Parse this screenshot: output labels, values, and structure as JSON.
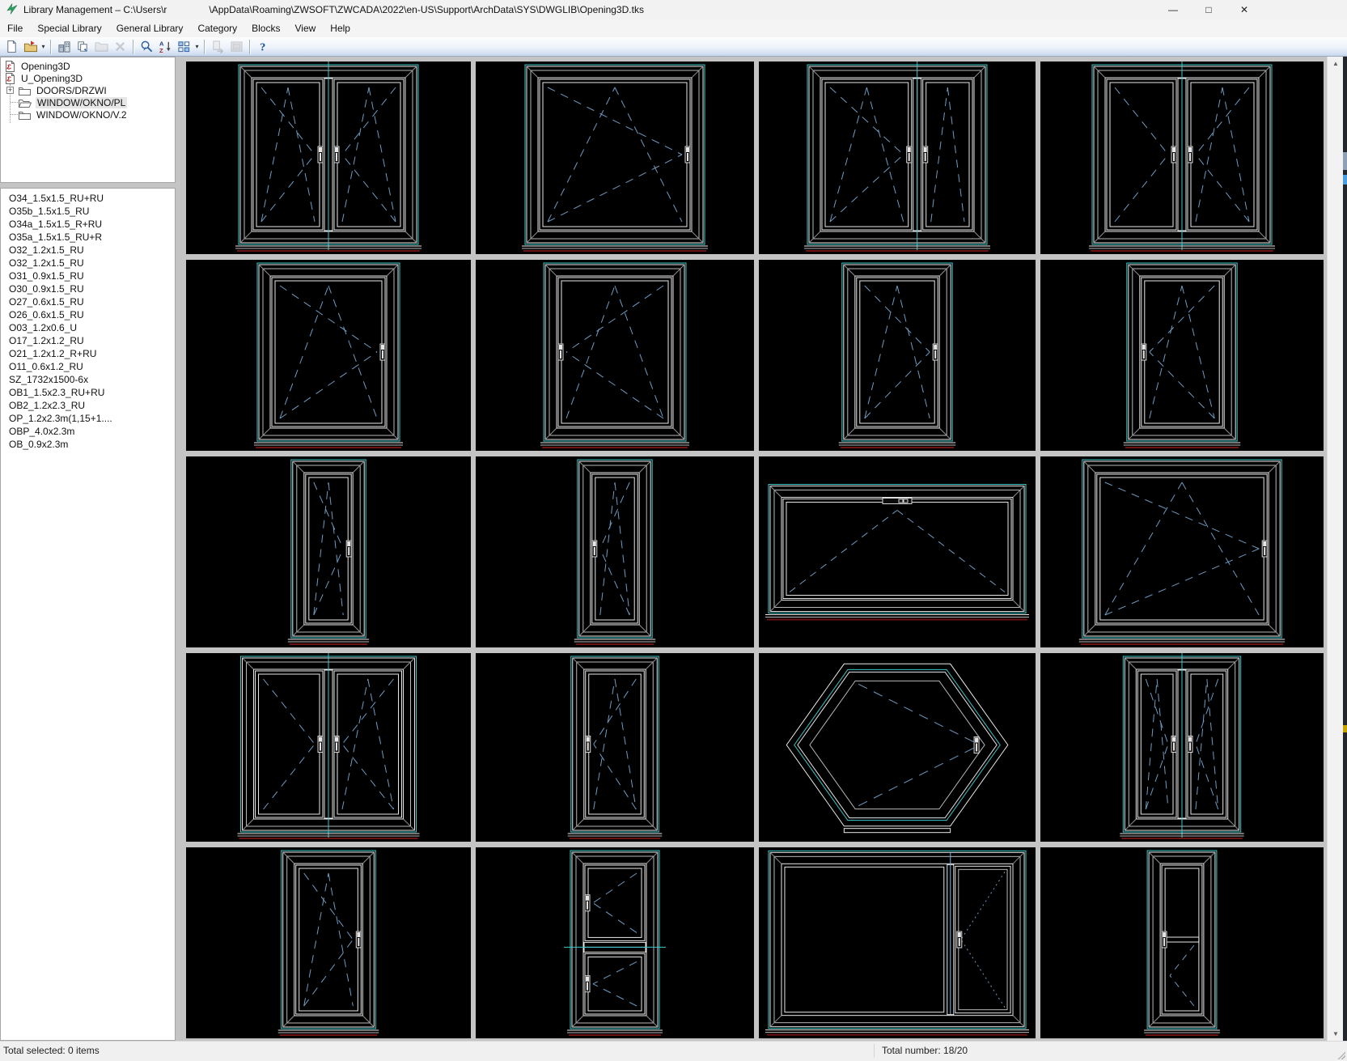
{
  "window": {
    "title_prefix": "Library Management – C:\\Users\\r",
    "title_path": "\\AppData\\Roaming\\ZWSOFT\\ZWCADA\\2022\\en-US\\Support\\ArchData\\SYS\\DWGLIB\\Opening3D.tks",
    "controls": {
      "minimize": "—",
      "maximize": "□",
      "close": "✕"
    }
  },
  "icons": {
    "caret": "▾",
    "scroll_up": "▲",
    "scroll_down": "▼",
    "tree_expand": "+"
  },
  "menu": {
    "items": [
      "File",
      "Special Library",
      "General Library",
      "Category",
      "Blocks",
      "View",
      "Help"
    ]
  },
  "toolbar": {
    "buttons": [
      {
        "name": "new-button",
        "icon": "new-page-icon",
        "enabled": true
      },
      {
        "name": "open-button",
        "icon": "open-folder-icon",
        "enabled": true,
        "dropdown": true
      },
      {
        "sep": true
      },
      {
        "name": "library-button",
        "icon": "building-icon",
        "enabled": true
      },
      {
        "name": "copy-button",
        "icon": "copy-page-icon",
        "enabled": true
      },
      {
        "name": "folder-button",
        "icon": "folder-plain-icon",
        "enabled": false
      },
      {
        "name": "delete-button",
        "icon": "delete-x-icon",
        "enabled": false
      },
      {
        "sep": true
      },
      {
        "name": "find-button",
        "icon": "magnifier-icon",
        "enabled": true
      },
      {
        "name": "sort-button",
        "icon": "sort-az-icon",
        "enabled": true
      },
      {
        "name": "view-mode-button",
        "icon": "grid-view-icon",
        "enabled": true,
        "dropdown": true
      },
      {
        "sep": true
      },
      {
        "name": "transfer-button",
        "icon": "page-arrow-icon",
        "enabled": false
      },
      {
        "name": "image-button",
        "icon": "image-box-icon",
        "enabled": false
      },
      {
        "sep": true
      },
      {
        "name": "help-button",
        "icon": "help-icon",
        "enabled": true
      }
    ]
  },
  "tree": {
    "items": [
      {
        "label": "Opening3D",
        "icon": "library-file",
        "level": 0
      },
      {
        "label": "U_Opening3D",
        "icon": "library-file",
        "level": 0
      },
      {
        "label": "DOORS/DRZWI",
        "icon": "folder",
        "level": 1,
        "expandable": true
      },
      {
        "label": "WINDOW/OKNO/PL",
        "icon": "folder-open",
        "level": 1,
        "selected": true
      },
      {
        "label": "WINDOW/OKNO/V.2",
        "icon": "folder",
        "level": 1
      }
    ]
  },
  "list": {
    "items": [
      "O34_1.5x1.5_RU+RU",
      "O35b_1.5x1.5_RU",
      "O34a_1.5x1.5_R+RU",
      "O35a_1.5x1.5_RU+R",
      "O32_1.2x1.5_RU",
      "O32_1.2x1.5_RU",
      "O31_0.9x1.5_RU",
      "O30_0.9x1.5_RU",
      "O27_0.6x1.5_RU",
      "O26_0.6x1.5_RU",
      "O03_1.2x0.6_U",
      "O17_1.2x1.2_RU",
      "O21_1.2x1.2_R+RU",
      "O11_0.6x1.2_RU",
      "SZ_1732x1500-6x",
      "OB1_1.5x2.3_RU+RU",
      "OB2_1.2x2.3_RU",
      "OP_1.2x2.3m(1,15+1....",
      "OBP_4.0x2.3m",
      "OB_0.9x2.3m"
    ]
  },
  "status": {
    "left": "Total selected: 0 items",
    "right": "Total number: 18/20"
  },
  "colors": {
    "cyan": "#3cc8c8",
    "frame": "#e8e8e8",
    "frame2": "#b9b9b9",
    "dim": "#8f8f8f",
    "dash": "#6e9cc2",
    "red": "#6b1212",
    "slide_blue": "#7ab3e0",
    "handle_fill": "#e6e6e6",
    "handle_stroke": "#d9d9d9",
    "tile_bg": "#000000",
    "gutter": "#c4c4c4"
  },
  "grid": {
    "tiles": [
      {
        "label": "O34_1.5x1.5_RU+RU",
        "kind": "rect",
        "aspect": 1.0,
        "centerline": true,
        "leaves": [
          {
            "frac": 0.5,
            "sym": "tiltturn",
            "handle": "right"
          },
          {
            "frac": 0.5,
            "sym": "tiltturn",
            "handle": "left"
          }
        ]
      },
      {
        "label": "O35b_1.5x1.5_RU",
        "kind": "rect",
        "aspect": 1.0,
        "leaves": [
          {
            "frac": 1,
            "sym": "tiltturn",
            "handle": "right"
          }
        ]
      },
      {
        "label": "O34a_1.5x1.5_R+RU",
        "kind": "rect",
        "aspect": 1.0,
        "centerline": true,
        "leaves": [
          {
            "frac": 0.63,
            "sym": "tiltturn",
            "handle": "right"
          },
          {
            "frac": 0.37,
            "sym": "tilt",
            "handle": "left"
          }
        ]
      },
      {
        "label": "O35a_1.5x1.5_RU+R",
        "kind": "rect",
        "aspect": 1.0,
        "centerline": true,
        "leaves": [
          {
            "frac": 0.5,
            "sym": "turn",
            "handle": "right"
          },
          {
            "frac": 0.5,
            "sym": "tiltturn",
            "handle": "left"
          }
        ]
      },
      {
        "label": "O32_1.2x1.5_RU",
        "kind": "rect",
        "aspect": 0.8,
        "leaves": [
          {
            "frac": 1,
            "sym": "tiltturn",
            "handle": "right"
          }
        ]
      },
      {
        "label": "O32_1.2x1.5_RU",
        "kind": "rect",
        "aspect": 0.8,
        "leaves": [
          {
            "frac": 1,
            "sym": "tiltturn",
            "handle": "left"
          }
        ]
      },
      {
        "label": "O31_0.9x1.5_RU",
        "kind": "rect",
        "aspect": 0.62,
        "leaves": [
          {
            "frac": 1,
            "sym": "tiltturn",
            "handle": "right"
          }
        ]
      },
      {
        "label": "O30_0.9x1.5_RU",
        "kind": "rect",
        "aspect": 0.62,
        "leaves": [
          {
            "frac": 1,
            "sym": "tiltturn",
            "handle": "left"
          }
        ]
      },
      {
        "label": "O27_0.6x1.5_RU",
        "kind": "rect",
        "aspect": 0.42,
        "leaves": [
          {
            "frac": 1,
            "sym": "tiltturn",
            "handle": "right"
          }
        ]
      },
      {
        "label": "O26_0.6x1.5_RU",
        "kind": "rect",
        "aspect": 0.42,
        "leaves": [
          {
            "frac": 1,
            "sym": "tiltturn",
            "handle": "left"
          }
        ]
      },
      {
        "label": "O03_1.2x0.6_U",
        "kind": "rect",
        "aspect": 2.0,
        "leaves": [
          {
            "frac": 1,
            "sym": "tilt",
            "handle": "top"
          }
        ]
      },
      {
        "label": "O17_1.2x1.2_RU",
        "kind": "rect",
        "aspect": 1.12,
        "leaves": [
          {
            "frac": 1,
            "sym": "tiltturn",
            "handle": "right"
          }
        ]
      },
      {
        "label": "O21_1.2x1.2_R+RU",
        "kind": "rect",
        "aspect": 1.0,
        "centerline": true,
        "leaves": [
          {
            "frac": 0.5,
            "sym": "turn",
            "handle": "right"
          },
          {
            "frac": 0.5,
            "sym": "tiltturn",
            "handle": "left"
          }
        ]
      },
      {
        "label": "O11_0.6x1.2_RU",
        "kind": "rect",
        "aspect": 0.5,
        "leaves": [
          {
            "frac": 1,
            "sym": "tiltturn",
            "handle": "left"
          }
        ]
      },
      {
        "label": "SZ_1732x1500-6x",
        "kind": "hex",
        "aspect": 1.32
      },
      {
        "label": "OB1_1.5x2.3_RU+RU",
        "kind": "rect",
        "aspect": 0.67,
        "centerline": true,
        "leaves": [
          {
            "frac": 0.5,
            "sym": "tiltturn",
            "handle": "right"
          },
          {
            "frac": 0.5,
            "sym": "tiltturn",
            "handle": "left"
          }
        ]
      },
      {
        "label": "OB2_1.2x2.3_RU",
        "kind": "rect",
        "aspect": 0.53,
        "leaves": [
          {
            "frac": 1,
            "sym": "tiltturn",
            "handle": "right"
          }
        ]
      },
      {
        "label": "OP_1.2x2.3m(1,15+1....",
        "kind": "stacked",
        "aspect": 0.5,
        "split": 0.55
      },
      {
        "label": "OBP_4.0x2.3m",
        "kind": "slider",
        "aspect": 1.45,
        "divider": 0.73
      },
      {
        "label": "OB_0.9x2.3m",
        "kind": "midrail",
        "aspect": 0.39,
        "rail": 0.5
      }
    ]
  }
}
